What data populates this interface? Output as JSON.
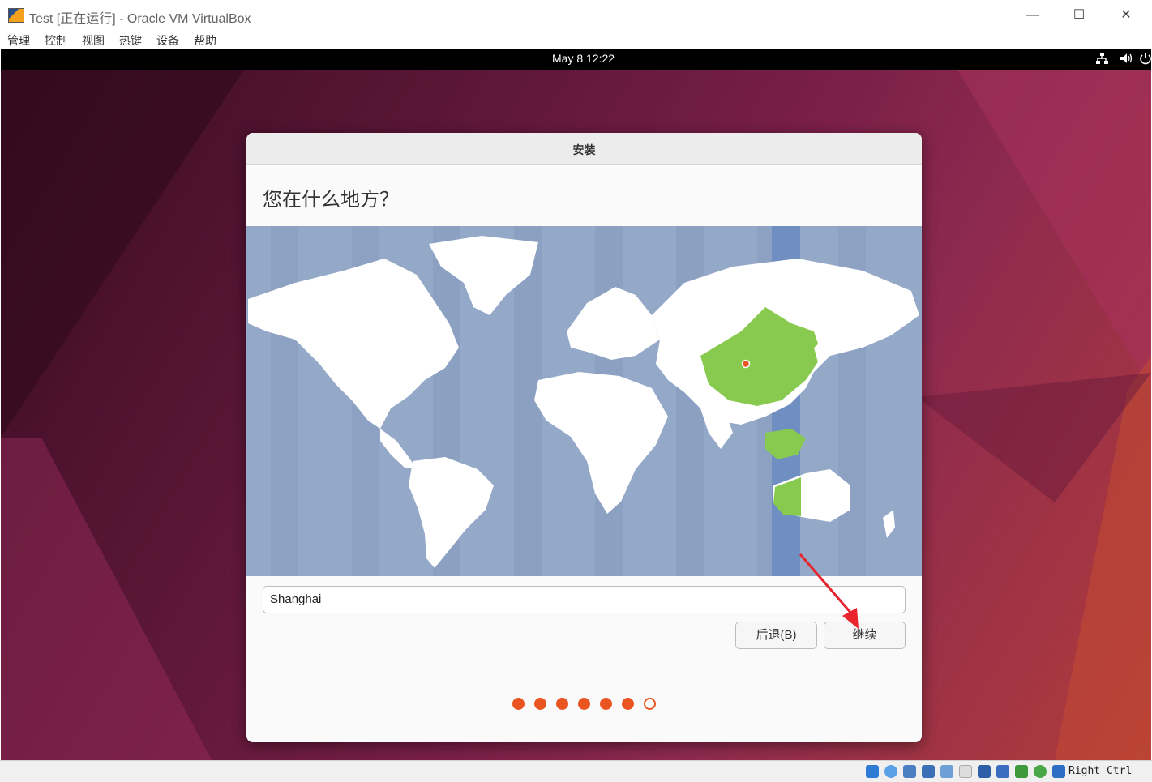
{
  "window": {
    "title": "Test [正在运行] - Oracle VM VirtualBox",
    "minimize_label": "—",
    "maximize_label": "☐",
    "close_label": "✕"
  },
  "menubar": {
    "items": [
      {
        "label": "管理"
      },
      {
        "label": "控制"
      },
      {
        "label": "视图"
      },
      {
        "label": "热键"
      },
      {
        "label": "设备"
      },
      {
        "label": "帮助"
      }
    ]
  },
  "guest_topbar": {
    "datetime": "May 8  12:22",
    "icons": [
      "network-icon",
      "volume-icon",
      "power-icon"
    ]
  },
  "installer": {
    "window_title": "安装",
    "question": "您在什么地方？",
    "location_value": "Shanghai",
    "back_label": "后退(B)",
    "continue_label": "继续",
    "progress": {
      "total": 7,
      "completed": 6
    }
  },
  "colors": {
    "accent": "#e95420",
    "map_water": "#94a8c8",
    "map_highlight": "#88c94f",
    "tz_band": "#6f8fc2"
  },
  "statusbar": {
    "host_key": "Right Ctrl"
  }
}
